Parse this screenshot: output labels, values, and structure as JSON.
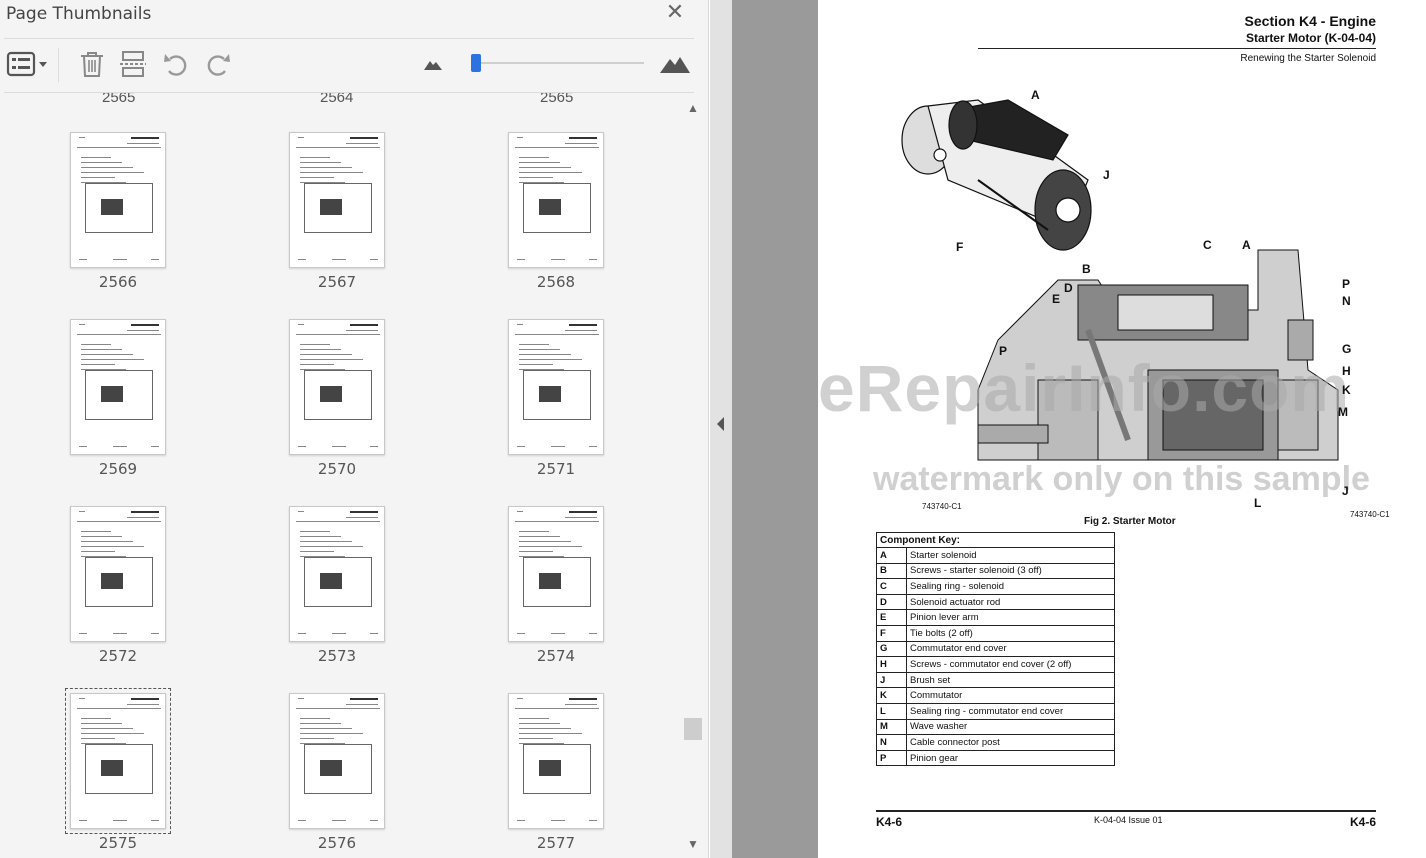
{
  "panel": {
    "title": "Page Thumbnails",
    "toolbar": {
      "options": "thumbnail-options-icon",
      "delete": "trash-icon",
      "insert": "insert-pages-icon",
      "rotate_ccw": "rotate-counterclockwise-icon",
      "rotate_cw": "rotate-clockwise-icon",
      "zoom_out": "small-mountain-icon",
      "zoom_in": "large-mountain-icon"
    },
    "thumbnail_size": 0.0,
    "cut_row": [
      "2565",
      "2564",
      "2565"
    ],
    "thumbnails": [
      {
        "page": "2566"
      },
      {
        "page": "2567"
      },
      {
        "page": "2568"
      },
      {
        "page": "2569"
      },
      {
        "page": "2570"
      },
      {
        "page": "2571"
      },
      {
        "page": "2572"
      },
      {
        "page": "2573"
      },
      {
        "page": "2574"
      },
      {
        "page": "2575",
        "selected": true
      },
      {
        "page": "2576"
      },
      {
        "page": "2577"
      }
    ],
    "scroll_position": 0.86,
    "accent": "#2b73e0"
  },
  "document": {
    "section": "Section K4 - Engine",
    "subsection": "Starter Motor (K-04-04)",
    "subtitle": "Renewing the Starter Solenoid",
    "watermark_line1": "eRepairInfo.com",
    "watermark_line2": "watermark only on this sample",
    "figure_code_left": "743740-C1",
    "figure_code_right": "743740-C1",
    "figure_caption": "Fig 2. Starter Motor",
    "callouts": [
      "A",
      "J",
      "F",
      "C",
      "A",
      "B",
      "P",
      "D",
      "N",
      "E",
      "P",
      "G",
      "H",
      "K",
      "M",
      "J",
      "L"
    ],
    "key_title": "Component Key:",
    "component_key": [
      {
        "k": "A",
        "v": "Starter solenoid"
      },
      {
        "k": "B",
        "v": "Screws - starter solenoid (3 off)"
      },
      {
        "k": "C",
        "v": "Sealing ring - solenoid"
      },
      {
        "k": "D",
        "v": "Solenoid actuator rod"
      },
      {
        "k": "E",
        "v": "Pinion lever arm"
      },
      {
        "k": "F",
        "v": "Tie bolts (2 off)"
      },
      {
        "k": "G",
        "v": "Commutator end cover"
      },
      {
        "k": "H",
        "v": "Screws - commutator end cover (2 off)"
      },
      {
        "k": "J",
        "v": "Brush set"
      },
      {
        "k": "K",
        "v": "Commutator"
      },
      {
        "k": "L",
        "v": "Sealing ring - commutator end cover"
      },
      {
        "k": "M",
        "v": "Wave washer"
      },
      {
        "k": "N",
        "v": "Cable connector post"
      },
      {
        "k": "P",
        "v": "Pinion gear"
      }
    ],
    "footer_left": "K4-6",
    "footer_center": "K-04-04 Issue 01",
    "footer_right": "K4-6"
  }
}
